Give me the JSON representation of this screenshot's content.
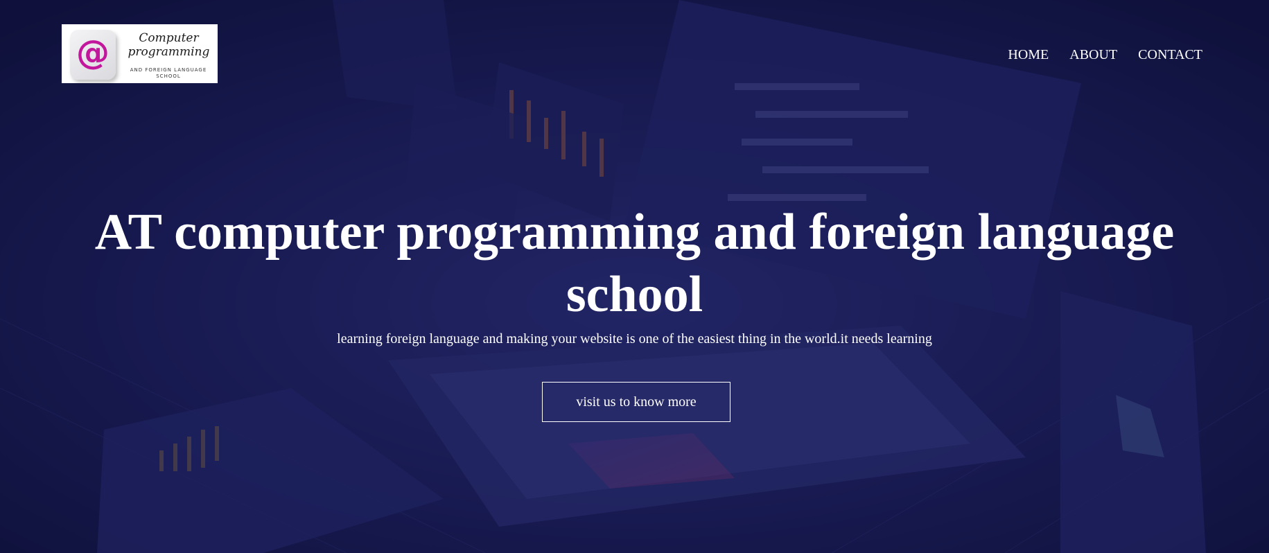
{
  "logo": {
    "symbol": "@",
    "title_line1": "Computer",
    "title_line2": "programming",
    "subtitle_line1": "AND FOREIGN LANGUAGE",
    "subtitle_line2": "SCHOOL"
  },
  "nav": {
    "items": [
      {
        "label": "HOME"
      },
      {
        "label": "ABOUT"
      },
      {
        "label": "CONTACT"
      }
    ]
  },
  "hero": {
    "title_line1": "AT computer programming and foreign language",
    "title_line2": "school",
    "subtitle": "learning foreign language and making your website is one of the easiest thing in the world.it needs learning",
    "cta_label": "visit us to know more",
    "background": {
      "icon": "laptop-dashboard-illustration",
      "primary_color": "#1b1d5c",
      "accent_color": "#8a3a9a"
    }
  }
}
